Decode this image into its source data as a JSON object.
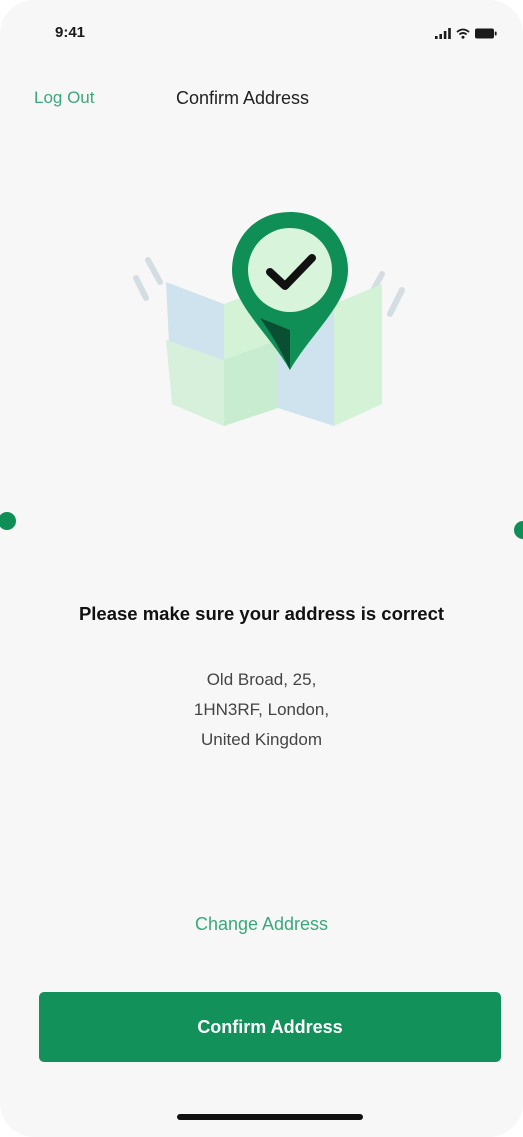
{
  "status_bar": {
    "time": "9:41",
    "signal_icon": "cellular-signal-icon",
    "wifi_icon": "wifi-icon",
    "battery_icon": "battery-icon"
  },
  "nav": {
    "logout_label": "Log Out",
    "title": "Confirm Address"
  },
  "illustration": {
    "name": "map-location-check-illustration",
    "colors": {
      "pin": "#0f8f55",
      "pin_dark": "#0a4f34",
      "pin_inner": "#d8f5dc",
      "check": "#111111",
      "map_blue": "#cfe3ee",
      "map_green": "#d3f2d6"
    }
  },
  "content": {
    "headline": "Please make sure your address is correct",
    "address_lines": [
      "Old Broad, 25,",
      "1HN3RF, London,",
      "United Kingdom"
    ]
  },
  "actions": {
    "change_label": "Change Address",
    "confirm_label": "Confirm Address"
  },
  "colors": {
    "accent": "#12925a",
    "link": "#3aa87c",
    "background": "#f7f7f7"
  }
}
